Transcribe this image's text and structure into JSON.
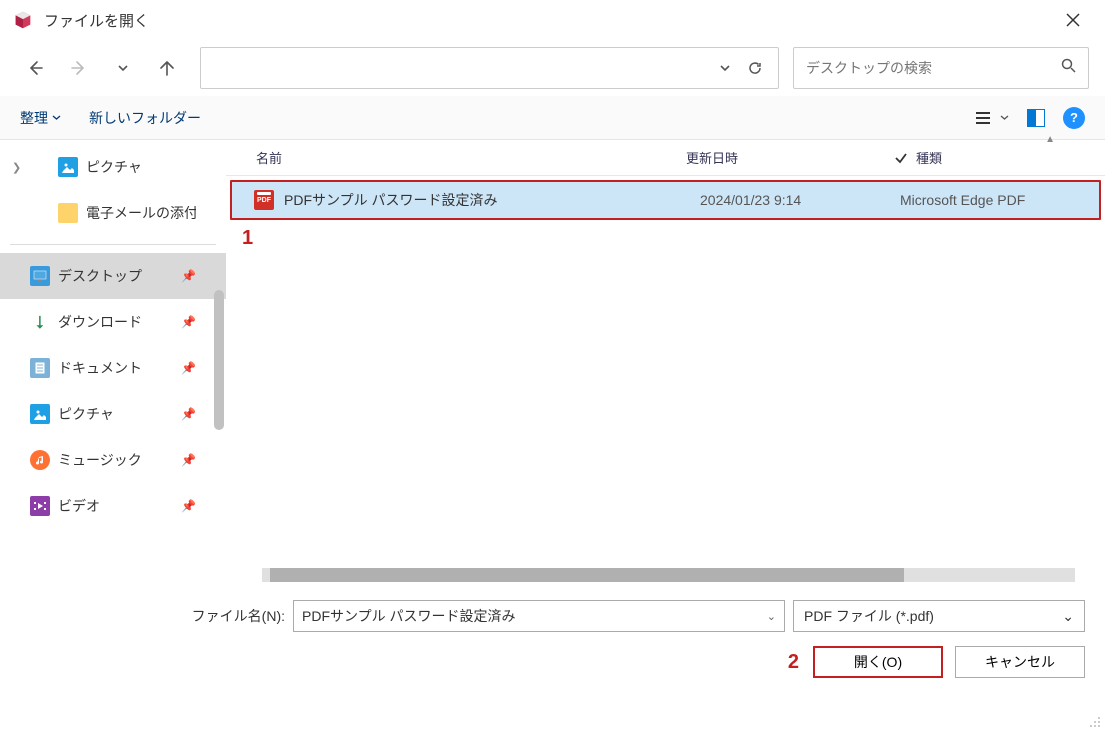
{
  "title": "ファイルを開く",
  "search_placeholder": "デスクトップの検索",
  "toolbar": {
    "organize": "整理",
    "new_folder": "新しいフォルダー"
  },
  "sidebar": {
    "pictures": "ピクチャ",
    "email_attach": "電子メールの添付",
    "desktop": "デスクトップ",
    "downloads": "ダウンロード",
    "documents": "ドキュメント",
    "pictures2": "ピクチャ",
    "music": "ミュージック",
    "videos": "ビデオ"
  },
  "columns": {
    "name": "名前",
    "date": "更新日時",
    "type": "種類"
  },
  "file": {
    "name": "PDFサンプル パスワード設定済み",
    "date": "2024/01/23 9:14",
    "type": "Microsoft Edge PDF"
  },
  "annotations": {
    "one": "1",
    "two": "2"
  },
  "filename_label": "ファイル名(N):",
  "filename_value": "PDFサンプル パスワード設定済み",
  "filter": "PDF ファイル (*.pdf)",
  "open_btn": "開く(O)",
  "cancel_btn": "キャンセル",
  "help_char": "?"
}
